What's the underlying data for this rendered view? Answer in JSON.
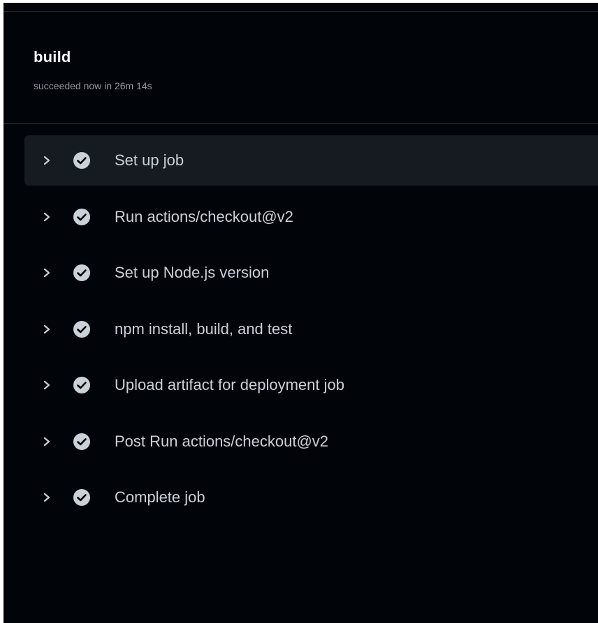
{
  "job": {
    "name": "build",
    "status": "succeeded now in 26m 14s"
  },
  "steps": [
    {
      "label": "Set up job",
      "status": "success",
      "icon": "check-circle-icon",
      "expand_icon": "chevron-right-icon"
    },
    {
      "label": "Run actions/checkout@v2",
      "status": "success",
      "icon": "check-circle-icon",
      "expand_icon": "chevron-right-icon"
    },
    {
      "label": "Set up Node.js version",
      "status": "success",
      "icon": "check-circle-icon",
      "expand_icon": "chevron-right-icon"
    },
    {
      "label": "npm install, build, and test",
      "status": "success",
      "icon": "check-circle-icon",
      "expand_icon": "chevron-right-icon"
    },
    {
      "label": "Upload artifact for deployment job",
      "status": "success",
      "icon": "check-circle-icon",
      "expand_icon": "chevron-right-icon"
    },
    {
      "label": "Post Run actions/checkout@v2",
      "status": "success",
      "icon": "check-circle-icon",
      "expand_icon": "chevron-right-icon"
    },
    {
      "label": "Complete job",
      "status": "success",
      "icon": "check-circle-icon",
      "expand_icon": "chevron-right-icon"
    }
  ],
  "colors": {
    "background": "#010409",
    "active_row": "#161b22",
    "title": "#f0f6fc",
    "muted": "#9198a1",
    "step_text": "#c9d1d9",
    "check_icon": "#c9d1d9"
  }
}
